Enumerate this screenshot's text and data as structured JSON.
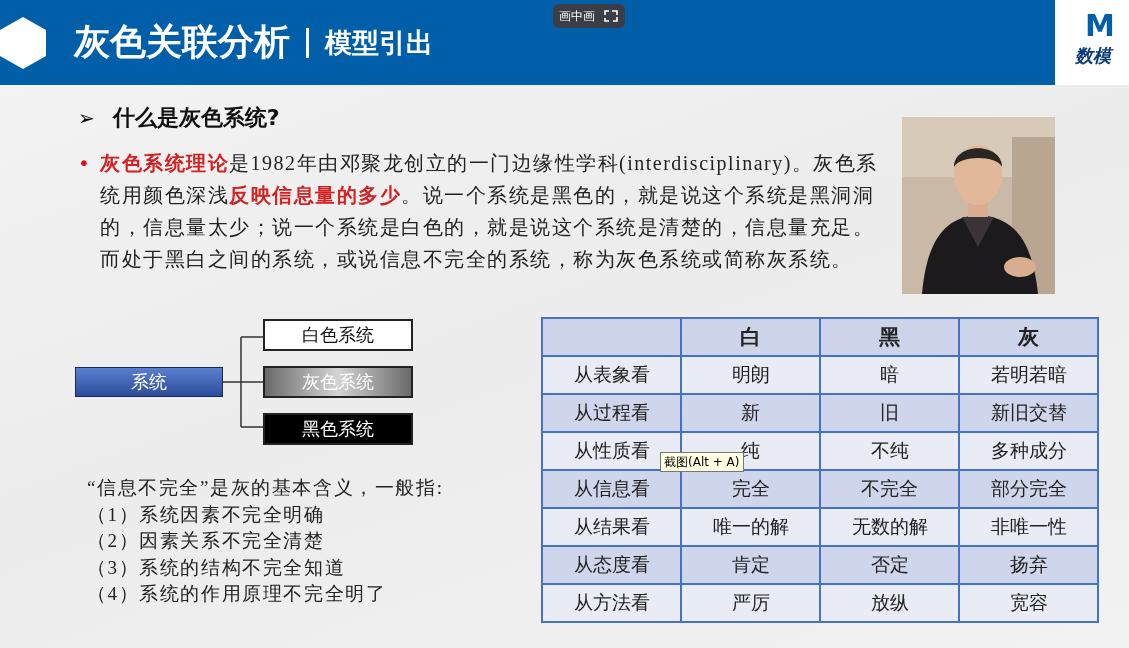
{
  "header": {
    "title": "灰色关联分析",
    "subtitle": "模型引出",
    "logo": {
      "letter": "M",
      "text": "数模"
    }
  },
  "pip_button": {
    "label": "画中画"
  },
  "section": {
    "bullet": "➢",
    "heading": "什么是灰色系统?"
  },
  "intro": {
    "bullet": "•",
    "text": "**灰色系统理论**是1982年由邓聚龙创立的一门边缘性学科(interdisciplinary)。灰色系统用颜色深浅**反映信息量的多少**。说一个系统是黑色的，就是说这个系统是黑洞洞的，信息量太少；说一个系统是白色的，就是说这个系统是清楚的，信息量充足。而处于黑白之间的系统，或说信息不完全的系统，称为灰色系统或简称灰系统。"
  },
  "diagram": {
    "root": "系统",
    "branches": [
      {
        "label": "白色系统",
        "kind": "white"
      },
      {
        "label": "灰色系统",
        "kind": "gray"
      },
      {
        "label": "黑色系统",
        "kind": "black"
      }
    ]
  },
  "notes": {
    "lead": "“信息不完全”是灰的基本含义，一般指:",
    "items": [
      "（1）系统因素不完全明确",
      "（2）因素关系不完全清楚",
      "（3）系统的结构不完全知道",
      "（4）系统的作用原理不完全明了"
    ]
  },
  "table": {
    "columns": [
      "白",
      "黑",
      "灰"
    ],
    "rows": [
      {
        "label": "从表象看",
        "cells": [
          "明朗",
          "暗",
          "若明若暗"
        ]
      },
      {
        "label": "从过程看",
        "cells": [
          "新",
          "旧",
          "新旧交替"
        ]
      },
      {
        "label": "从性质看",
        "cells": [
          "纯",
          "不纯",
          "多种成分"
        ]
      },
      {
        "label": "从信息看",
        "cells": [
          "完全",
          "不完全",
          "部分完全"
        ]
      },
      {
        "label": "从结果看",
        "cells": [
          "唯一的解",
          "无数的解",
          "非唯一性"
        ]
      },
      {
        "label": "从态度看",
        "cells": [
          "肯定",
          "否定",
          "扬弃"
        ]
      },
      {
        "label": "从方法看",
        "cells": [
          "严厉",
          "放纵",
          "宽容"
        ]
      }
    ]
  },
  "tooltip": {
    "text": "截图(Alt + A)"
  }
}
